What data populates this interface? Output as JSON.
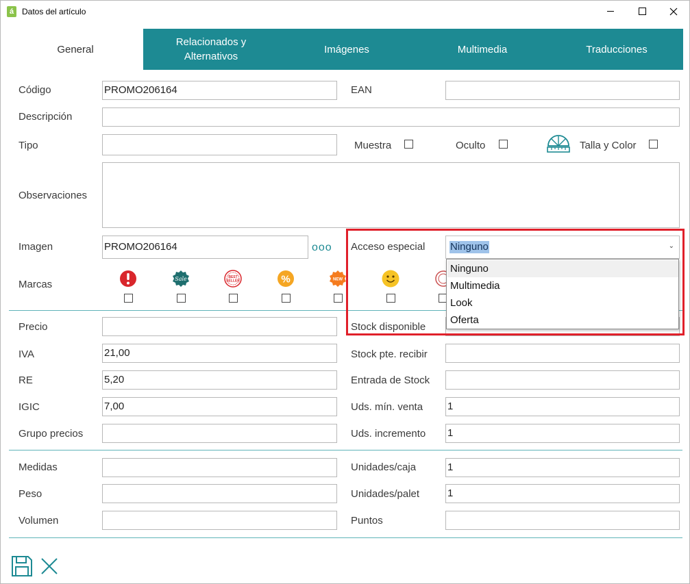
{
  "window": {
    "title": "Datos del artículo",
    "icon": "app-icon",
    "icon_glyph": "á"
  },
  "tabs": [
    {
      "label": "General"
    },
    {
      "label": "Relacionados y Alternativos"
    },
    {
      "label": "Imágenes"
    },
    {
      "label": "Multimedia"
    },
    {
      "label": "Traducciones"
    }
  ],
  "fields": {
    "codigo": {
      "label": "Código",
      "value": "PROMO206164"
    },
    "ean": {
      "label": "EAN",
      "value": ""
    },
    "descripcion": {
      "label": "Descripción",
      "value": ""
    },
    "tipo": {
      "label": "Tipo",
      "value": ""
    },
    "muestra": {
      "label": "Muestra"
    },
    "oculto": {
      "label": "Oculto"
    },
    "talla_color": {
      "label": "Talla y Color",
      "icon": "ruler-fan-icon"
    },
    "observaciones": {
      "label": "Observaciones",
      "value": ""
    },
    "imagen": {
      "label": "Imagen",
      "value": "PROMO206164",
      "more": "ooo"
    },
    "acceso_especial": {
      "label": "Acceso especial",
      "selected": "Ninguno",
      "options": [
        "Ninguno",
        "Multimedia",
        "Look",
        "Oferta"
      ]
    },
    "marcas": {
      "label": "Marcas",
      "icons": [
        "exclamation-icon",
        "sale-badge-icon",
        "best-seller-icon",
        "percent-icon",
        "new-badge-icon",
        "smiley-icon",
        "stamp-icon"
      ]
    }
  },
  "pricing": {
    "precio": {
      "label": "Precio",
      "value": ""
    },
    "iva": {
      "label": "IVA",
      "value": "21,00"
    },
    "re": {
      "label": "RE",
      "value": "5,20"
    },
    "igic": {
      "label": "IGIC",
      "value": "7,00"
    },
    "grupo_precios": {
      "label": "Grupo precios",
      "value": ""
    },
    "stock_disponible": {
      "label": "Stock disponible",
      "value": ""
    },
    "stock_pte": {
      "label": "Stock pte. recibir",
      "value": ""
    },
    "entrada_stock": {
      "label": "Entrada de Stock",
      "value": ""
    },
    "uds_min_venta": {
      "label": "Uds. mín. venta",
      "value": "1"
    },
    "uds_incremento": {
      "label": "Uds. incremento",
      "value": "1"
    }
  },
  "measures": {
    "medidas": {
      "label": "Medidas",
      "value": ""
    },
    "peso": {
      "label": "Peso",
      "value": ""
    },
    "volumen": {
      "label": "Volumen",
      "value": ""
    },
    "unidades_caja": {
      "label": "Unidades/caja",
      "value": "1"
    },
    "unidades_palet": {
      "label": "Unidades/palet",
      "value": "1"
    },
    "puntos": {
      "label": "Puntos",
      "value": ""
    }
  },
  "colors": {
    "accent": "#1d8a93",
    "highlight": "#e0202a",
    "selection": "#9fc3ea"
  }
}
